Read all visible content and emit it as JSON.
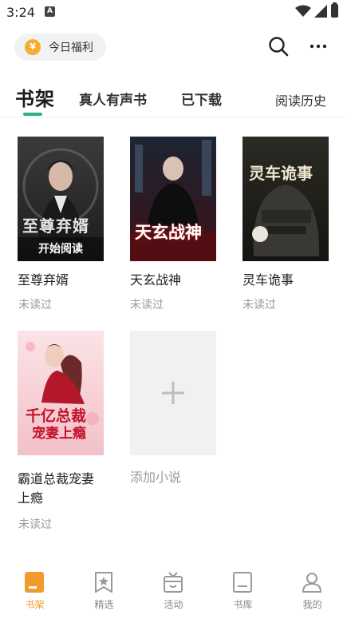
{
  "status_bar": {
    "time": "3:24",
    "notification_icon": "A"
  },
  "header": {
    "welfare_label": "今日福利",
    "coin_symbol": "¥",
    "search_icon": "search-icon",
    "more_icon": "more-icon"
  },
  "tabs": [
    {
      "label": "书架",
      "active": true
    },
    {
      "label": "真人有声书"
    },
    {
      "label": "已下载"
    },
    {
      "label": "阅读历史"
    }
  ],
  "colors": {
    "accent": "#2fb37c",
    "nav_active": "#f39a2c",
    "muted": "#9a9a9a"
  },
  "books": [
    {
      "title": "至尊弃婿",
      "cover_text": "至尊弃婿",
      "status": "未读过",
      "overlay": "开始阅读"
    },
    {
      "title": "天玄战神",
      "cover_text": "天玄战神",
      "status": "未读过"
    },
    {
      "title": "灵车诡事",
      "cover_text": "灵车诡事",
      "status": "未读过"
    },
    {
      "title_line1": "霸道总裁宠妻",
      "title_line2": "上瘾",
      "cover_text_line1": "千亿总裁",
      "cover_text_line2": "宠妻上瘾",
      "status": "未读过"
    }
  ],
  "add_novel": {
    "label": "添加小说"
  },
  "bottom_nav": [
    {
      "label": "书架",
      "icon": "bookshelf-icon",
      "active": true
    },
    {
      "label": "精选",
      "icon": "featured-icon"
    },
    {
      "label": "活动",
      "icon": "activity-icon"
    },
    {
      "label": "书库",
      "icon": "library-icon"
    },
    {
      "label": "我的",
      "icon": "profile-icon"
    }
  ]
}
